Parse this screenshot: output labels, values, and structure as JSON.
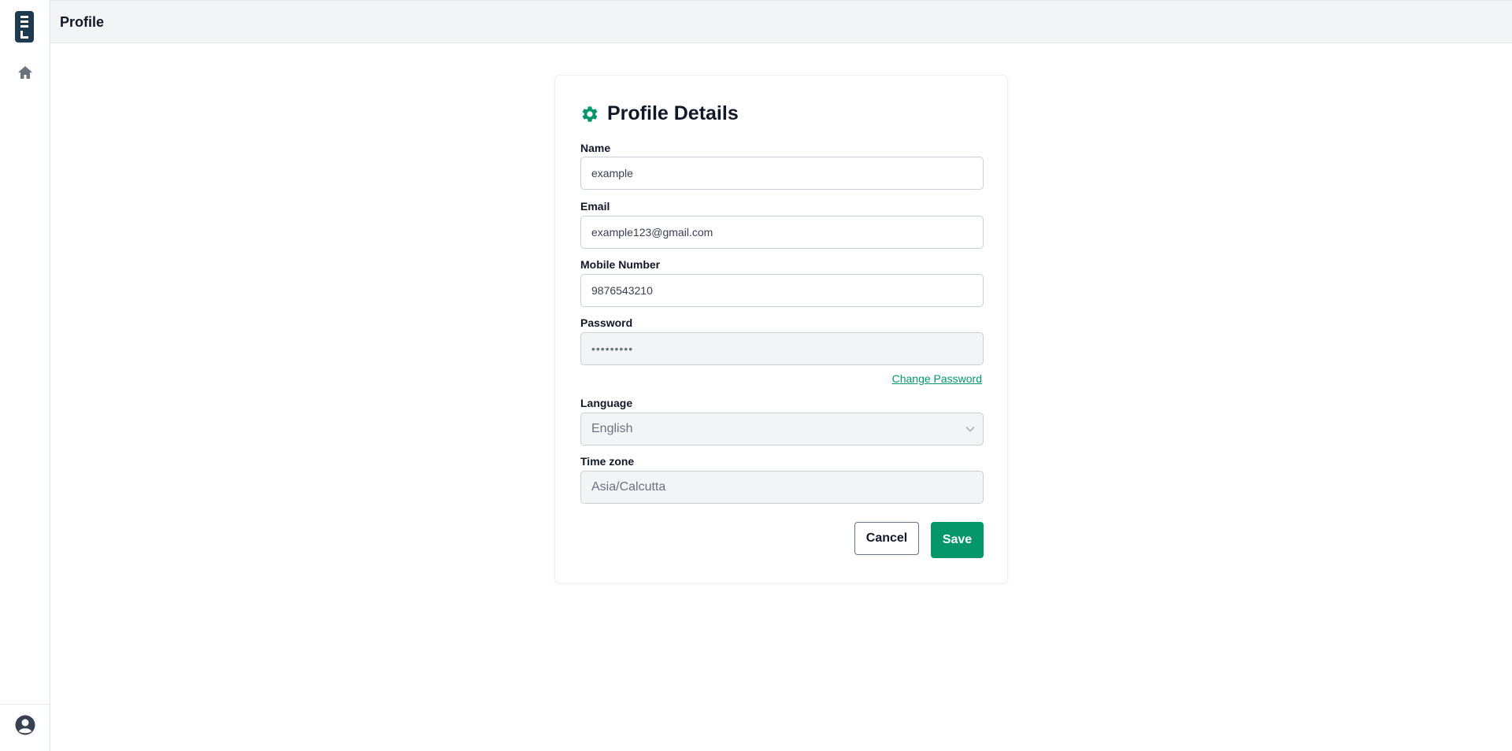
{
  "app": {
    "logo_name": "app-logo"
  },
  "header": {
    "title": "Profile"
  },
  "sidebar": {
    "home_icon": "home-icon",
    "user_icon": "user-circle-icon"
  },
  "card": {
    "title": "Profile Details",
    "icon": "gear-icon"
  },
  "form": {
    "name": {
      "label": "Name",
      "value": "example"
    },
    "email": {
      "label": "Email",
      "value": "example123@gmail.com"
    },
    "mobile": {
      "label": "Mobile Number",
      "value": "9876543210"
    },
    "password": {
      "label": "Password",
      "value": "•••••••••"
    },
    "change_password": "Change Password",
    "language": {
      "label": "Language",
      "value": "English"
    },
    "timezone": {
      "label": "Time zone",
      "value": "Asia/Calcutta"
    },
    "cancel_label": "Cancel",
    "save_label": "Save"
  },
  "colors": {
    "accent": "#059669",
    "logo": "#1e3a4f"
  }
}
